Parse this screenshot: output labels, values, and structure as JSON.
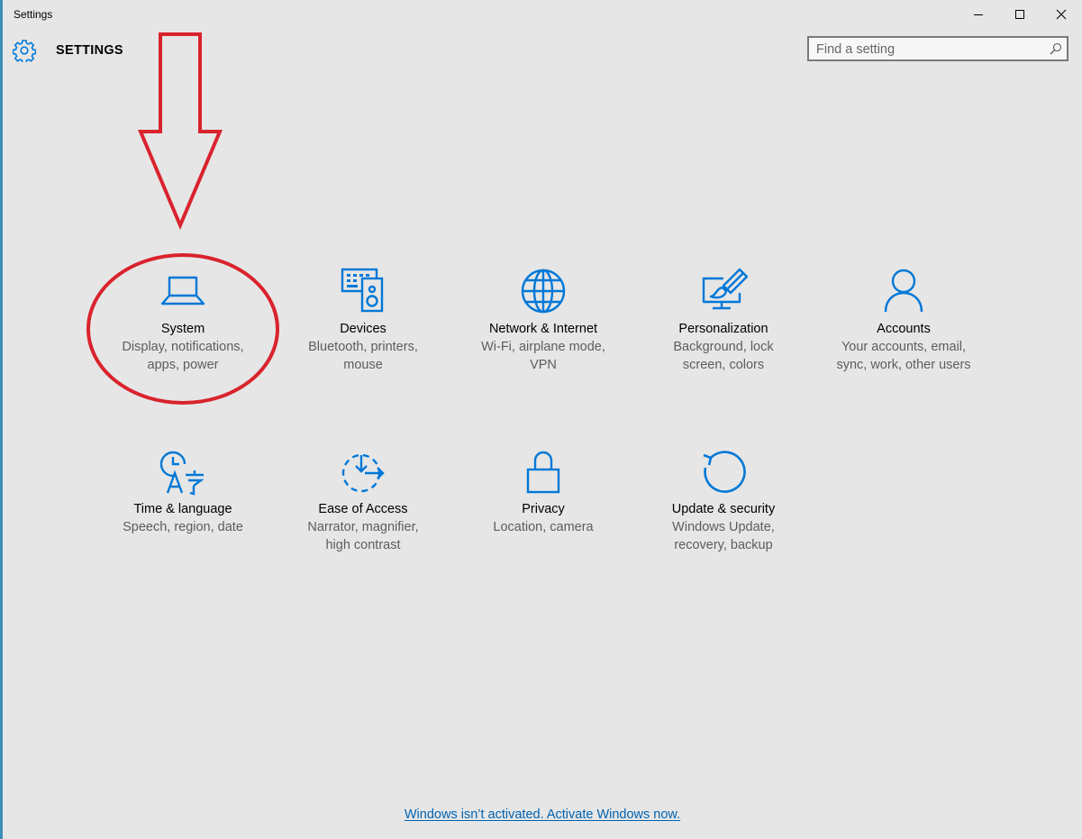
{
  "window": {
    "title": "Settings"
  },
  "header": {
    "title": "SETTINGS",
    "icon": "gear-icon"
  },
  "search": {
    "placeholder": "Find a setting",
    "value": ""
  },
  "accent_color": "#0078d7",
  "annotation_color": "#d9232d",
  "tiles": [
    {
      "id": "system",
      "icon": "laptop-icon",
      "name": "System",
      "desc_line1": "Display, notifications,",
      "desc_line2": "apps, power"
    },
    {
      "id": "devices",
      "icon": "keyboard-speaker-icon",
      "name": "Devices",
      "desc_line1": "Bluetooth, printers,",
      "desc_line2": "mouse"
    },
    {
      "id": "network",
      "icon": "globe-icon",
      "name": "Network & Internet",
      "desc_line1": "Wi-Fi, airplane mode,",
      "desc_line2": "VPN"
    },
    {
      "id": "personalization",
      "icon": "paint-monitor-icon",
      "name": "Personalization",
      "desc_line1": "Background, lock",
      "desc_line2": "screen, colors"
    },
    {
      "id": "accounts",
      "icon": "person-icon",
      "name": "Accounts",
      "desc_line1": "Your accounts, email,",
      "desc_line2": "sync, work, other users"
    },
    {
      "id": "time",
      "icon": "time-language-icon",
      "name": "Time & language",
      "desc_line1": "Speech, region, date",
      "desc_line2": ""
    },
    {
      "id": "ease",
      "icon": "ease-of-access-icon",
      "name": "Ease of Access",
      "desc_line1": "Narrator, magnifier,",
      "desc_line2": "high contrast"
    },
    {
      "id": "privacy",
      "icon": "lock-icon",
      "name": "Privacy",
      "desc_line1": "Location, camera",
      "desc_line2": ""
    },
    {
      "id": "update",
      "icon": "refresh-icon",
      "name": "Update & security",
      "desc_line1": "Windows Update,",
      "desc_line2": "recovery, backup"
    }
  ],
  "footer": {
    "activate_link": "Windows isn’t activated. Activate Windows now."
  }
}
